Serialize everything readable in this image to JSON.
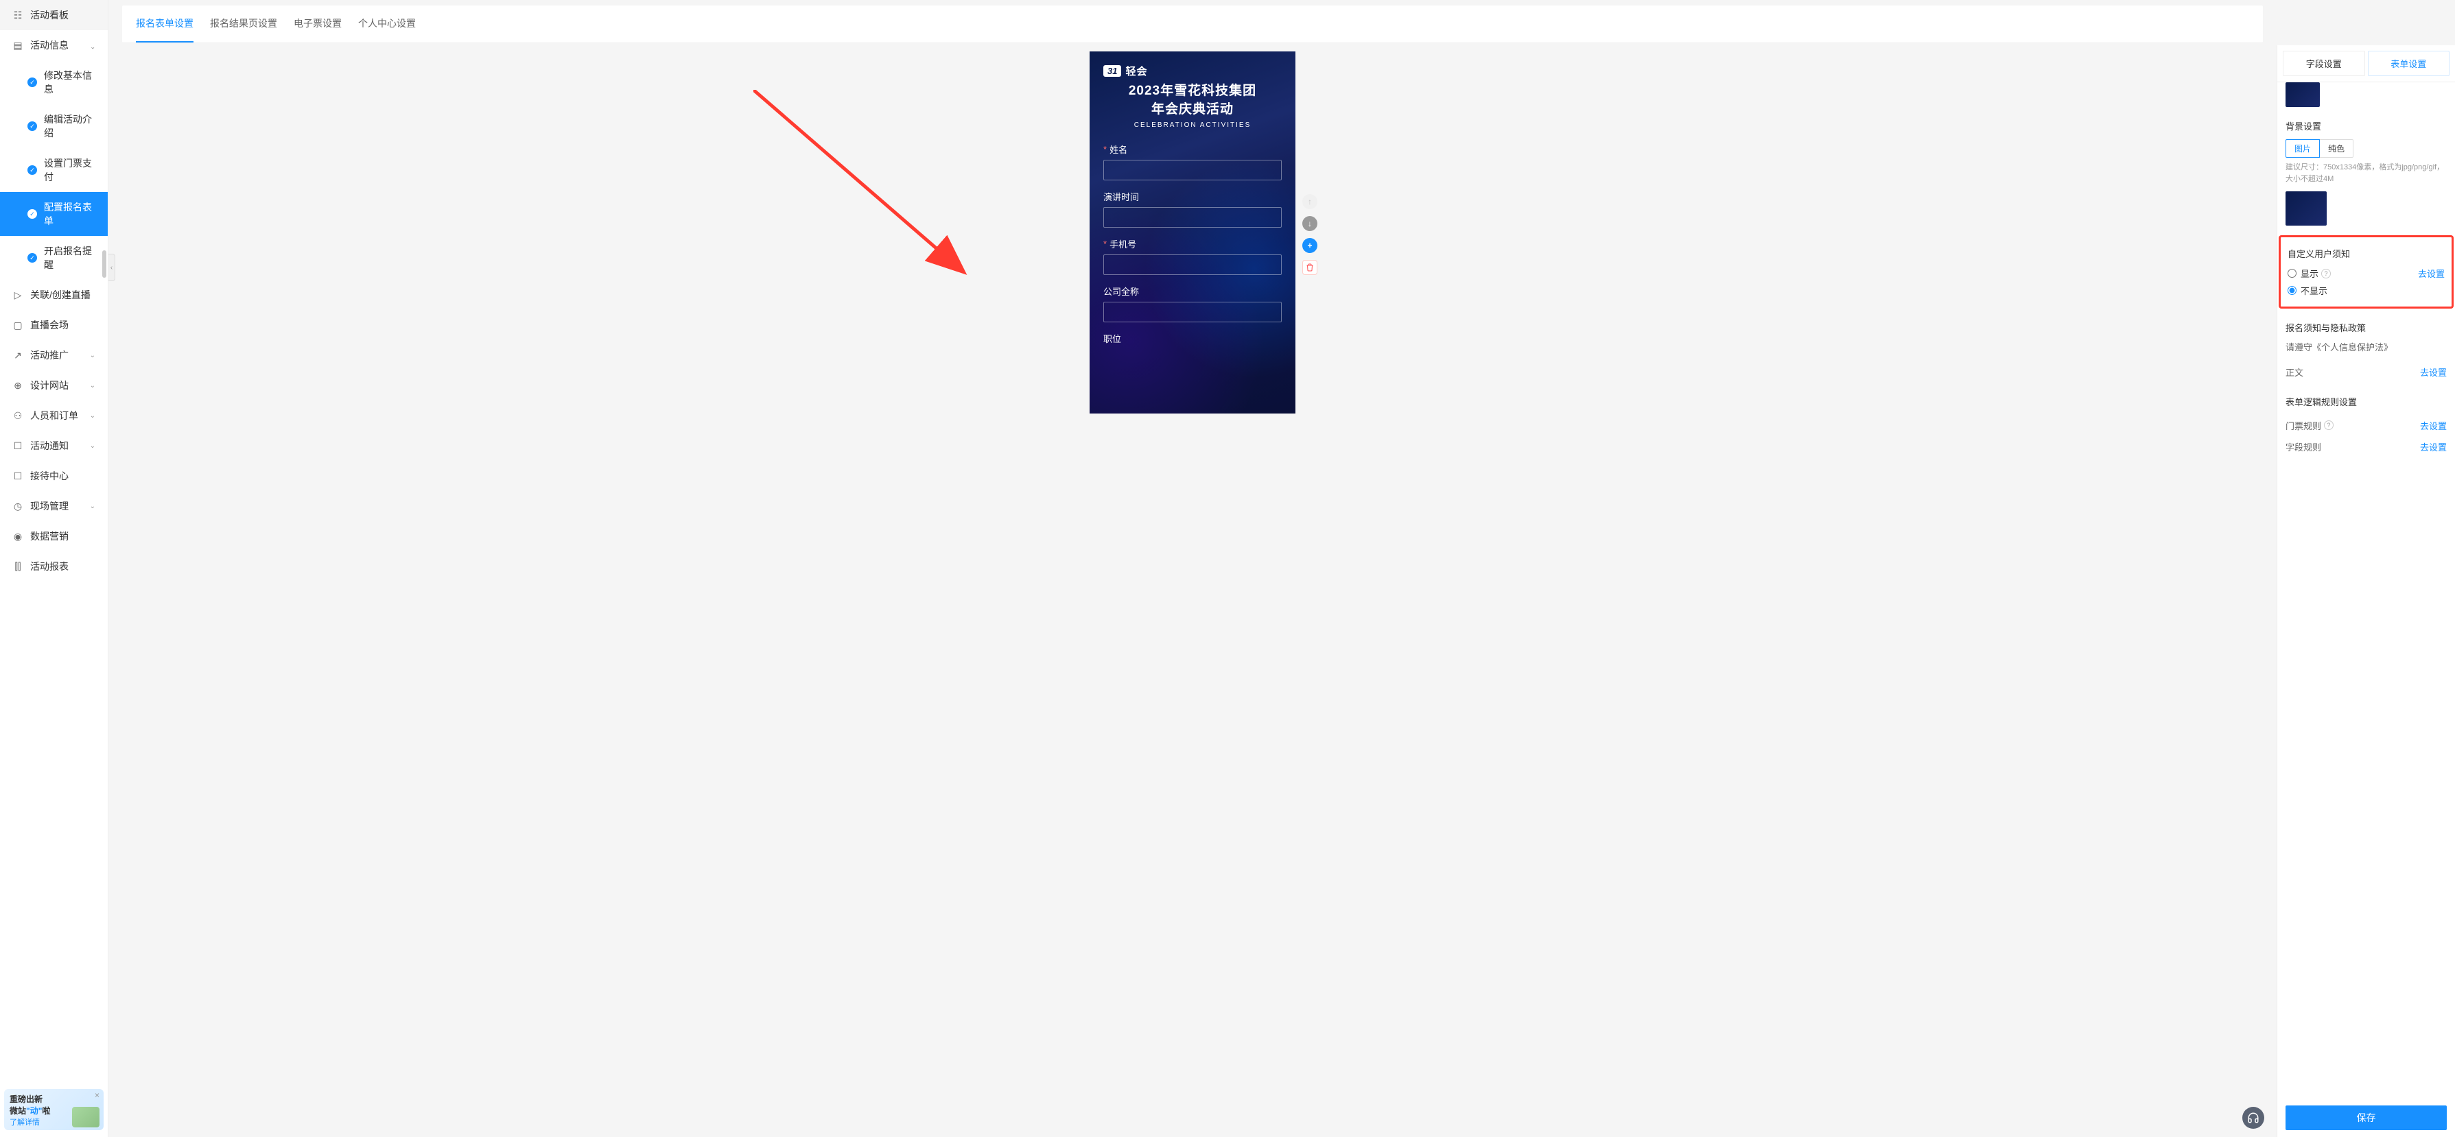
{
  "sidebar": {
    "items": [
      {
        "label": "活动看板",
        "icon": "calendar"
      },
      {
        "label": "活动信息",
        "icon": "note",
        "expanded": true
      },
      {
        "label": "修改基本信息",
        "sub": true,
        "check": true
      },
      {
        "label": "编辑活动介绍",
        "sub": true,
        "check": true
      },
      {
        "label": "设置门票支付",
        "sub": true,
        "check": true
      },
      {
        "label": "配置报名表单",
        "sub": true,
        "check": true,
        "active": true
      },
      {
        "label": "开启报名提醒",
        "sub": true,
        "check": true
      },
      {
        "label": "关联/创建直播",
        "icon": "video"
      },
      {
        "label": "直播会场",
        "icon": "monitor"
      },
      {
        "label": "活动推广",
        "icon": "share",
        "chevron": true
      },
      {
        "label": "设计网站",
        "icon": "globe",
        "chevron": true
      },
      {
        "label": "人员和订单",
        "icon": "people",
        "chevron": true
      },
      {
        "label": "活动通知",
        "icon": "chat",
        "chevron": true
      },
      {
        "label": "接待中心",
        "icon": "briefcase"
      },
      {
        "label": "现场管理",
        "icon": "timer",
        "chevron": true
      },
      {
        "label": "数据营销",
        "icon": "dashboard"
      },
      {
        "label": "活动报表",
        "icon": "chart"
      }
    ],
    "promo": {
      "line1_a": "重磅出新",
      "line2_a": "微站",
      "line2_b": "\"动\"",
      "line2_c": "啦",
      "link": "了解详情"
    }
  },
  "tabs": {
    "items": [
      "报名表单设置",
      "报名结果页设置",
      "电子票设置",
      "个人中心设置"
    ]
  },
  "preview": {
    "logo_badge": "31",
    "logo_text": "轻会",
    "title_line1": "2023年雪花科技集团",
    "title_line2": "年会庆典活动",
    "subtitle": "CELEBRATION ACTIVITIES",
    "fields": [
      {
        "label": "姓名",
        "required": true
      },
      {
        "label": "演讲时间",
        "required": false
      },
      {
        "label": "手机号",
        "required": true
      },
      {
        "label": "公司全称",
        "required": false
      },
      {
        "label": "职位",
        "required": false
      }
    ]
  },
  "panel": {
    "tabs": [
      "字段设置",
      "表单设置"
    ],
    "bg_section": {
      "title": "背景设置",
      "options": [
        "图片",
        "纯色"
      ],
      "hint": "建议尺寸：750x1334像素，格式为jpg/png/gif，大小不超过4M"
    },
    "notice_section": {
      "title": "自定义用户须知",
      "show": "显示",
      "hide": "不显示",
      "go_set": "去设置"
    },
    "privacy_section": {
      "title": "报名须知与隐私政策",
      "hint": "请遵守《个人信息保护法》",
      "body_label": "正文",
      "go_set": "去设置"
    },
    "logic_section": {
      "title": "表单逻辑规则设置",
      "ticket_rule": "门票规则",
      "field_rule": "字段规则",
      "go_set": "去设置"
    },
    "save": "保存"
  }
}
